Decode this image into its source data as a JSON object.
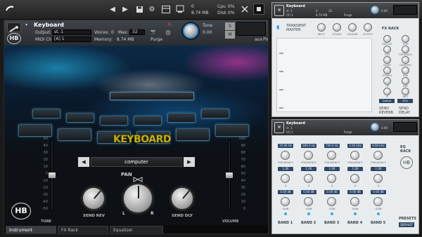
{
  "toolbar": {
    "cpu_label": "Cpu",
    "cpu_value": "0%",
    "disk_label": "Disk",
    "disk_value": "0%",
    "voices_label": "0",
    "memory_label": "8.74 MB",
    "icons": [
      "logo-icon",
      "prev-icon",
      "next-icon",
      "save-icon",
      "gear-icon",
      "rack-icon",
      "midi-icon",
      "master-icon",
      "panic-icon",
      "menu-icon",
      "view-icon",
      "close-icon"
    ]
  },
  "instrument": {
    "title": "Keyboard",
    "output_label": "Output:",
    "output_value": "st. 1",
    "midi_label": "MIDI Ch:",
    "midi_value": "[A] 1",
    "voices_label": "Voices:",
    "voices_value": "0",
    "max_label": "Max:",
    "max_value": "32",
    "memory_label": "Memory:",
    "memory_value": "8.74 MB",
    "purge_label": "Purge",
    "tune_label": "Tune",
    "tune_value": "0.00",
    "s_label": "S",
    "m_label": "M",
    "aux_label": "aux",
    "pv_label": "PV",
    "instrument_name": "KEYBOARD",
    "preset_value": "computer",
    "pan_label": "PAN",
    "pan_l": "L",
    "pan_r": "R",
    "send_rev_label": "SEND REV",
    "send_dly_label": "SEND DLY",
    "tune_slider_label": "TUNE",
    "volume_label": "VOLUME",
    "tune_ticks": [
      "50",
      "40",
      "30",
      "20",
      "10",
      "0",
      "-10",
      "-20",
      "-30",
      "-40",
      "-50"
    ],
    "volume_ticks": [
      "100",
      "90",
      "80",
      "70",
      "60",
      "50",
      "40",
      "30",
      "20",
      "10",
      "0"
    ],
    "tune_level": 0.5,
    "volume_level": 0.5,
    "tabs": [
      "Instrument",
      "FX Rack",
      "Equalizer"
    ]
  },
  "fx_rack": {
    "title": "Keyboard",
    "output_value": "st. 1",
    "midi_value": "[A] 1",
    "voices_value": "0",
    "max_value": "32",
    "memory_value": "8.74 MB",
    "purge_label": "Purge",
    "tune_value": "0.00",
    "transient_title": "TRANSIENT\nMASTER",
    "transient_knobs": [
      "INPUT",
      "ATTACK",
      "SUSTAIN",
      "OUTPUT"
    ],
    "fx_rack_label": "FX RACK",
    "fx_knobs": [
      "PRE DLY",
      "SIZE",
      "DAMP",
      "STEREO",
      "HP",
      "LP",
      "DRY",
      "WET"
    ],
    "delay_knobs": [
      "TIME",
      "FEEDBACK",
      "DAMPING",
      "PAN",
      "DRY",
      "WET"
    ],
    "sync_value": "Dotted Eighth",
    "mix_value": "45%",
    "send_reverb_label": "SEND\nREVERB",
    "send_delay_label": "SEND\nDELAY"
  },
  "equalizer": {
    "title": "Keyboard",
    "output_value": "st. 1",
    "midi_value": "[A] 1",
    "tune_value": "0.00",
    "purge_label": "Purge",
    "eq_rack_label": "EQ\nRACK",
    "frequency_values": [
      "70.00 Hz",
      "600.0 Hz",
      "700.0 Hz",
      "3.50 kHz",
      "9.00 kHz"
    ],
    "q_values": [
      "1.00",
      "1.00",
      "1.00",
      "1.00",
      "1.00"
    ],
    "gain_values": [
      "0.00 dB",
      "0.00 dB",
      "0.00 dB",
      "0.00 dB",
      "0.00 dB"
    ],
    "frequency_label": "FREQUENCY",
    "q_label": "Q",
    "gain_label": "GAIN",
    "bands": [
      "BAND 1",
      "BAND 2",
      "BAND 3",
      "BAND 4",
      "BAND 5"
    ],
    "presets_label": "PRESETS",
    "default_label": "DEFAULT"
  }
}
